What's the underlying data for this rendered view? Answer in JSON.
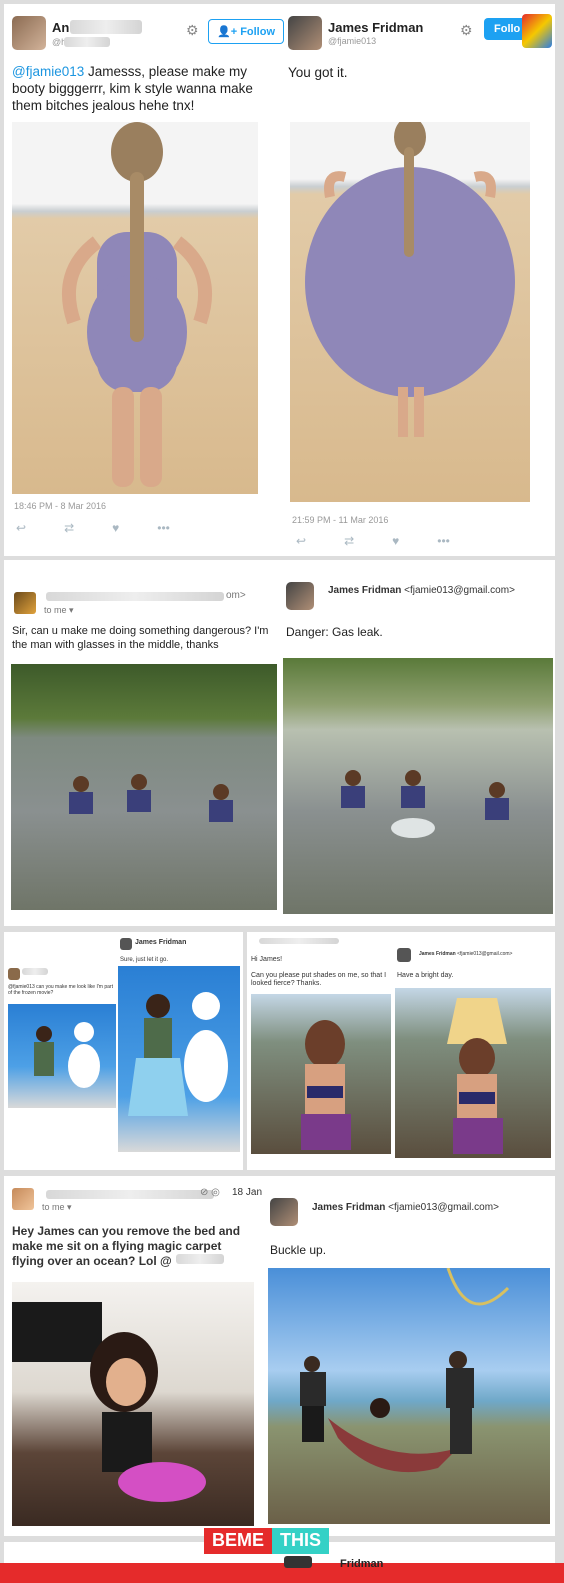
{
  "panel1": {
    "left": {
      "name": "An",
      "handle": "@h",
      "follow_label": "Follow",
      "text_mention": "@fjamie013",
      "text_body": " Jamesss, please make my booty bigggerrr, kim k style wanna make them bitches jealous hehe tnx!",
      "timestamp": "18:46 PM - 8 Mar 2016"
    },
    "right": {
      "name": "James Fridman",
      "handle": "@fjamie013",
      "follow_label": "Follo",
      "text": "You got it.",
      "timestamp": "21:59 PM - 11 Mar 2016"
    }
  },
  "panel2": {
    "left": {
      "sender_tail": "om>",
      "to_me": "to me",
      "text": "Sir, can u make me doing something dangerous? I'm the man with glasses in the middle, thanks"
    },
    "right": {
      "sender": "James Fridman",
      "email": "<fjamie013@gmail.com>",
      "text": "Danger: Gas leak."
    }
  },
  "panel3": {
    "a": {
      "name": "James Fridman",
      "reply": "Sure, just let it go.",
      "question": "@fjamie013 can you make me look like I'm part of the frozen movie?"
    },
    "b": {
      "greeting": "Hi James!",
      "request": "Can you please put shades on me, so that I looked fierce? Thanks.",
      "sender": "James Fridman",
      "email": "<fjamie013@gmail.com>",
      "reply": "Have a bright day."
    }
  },
  "panel4": {
    "left": {
      "date": "18 Jan",
      "to_me": "to me",
      "text": "Hey James can you remove the bed and make me sit on a flying magic carpet flying over an ocean? Lol @"
    },
    "right": {
      "sender": "James Fridman",
      "email": "<fjamie013@gmail.com>",
      "text": "Buckle up."
    }
  },
  "watermark": {
    "left": "BEME",
    "right": "THIS"
  },
  "footer": {
    "partial_name": "Fridman"
  },
  "colors": {
    "twitter_blue": "#1da1f2",
    "beme_red": "#e52b2b",
    "this_teal": "#34d1c6"
  }
}
